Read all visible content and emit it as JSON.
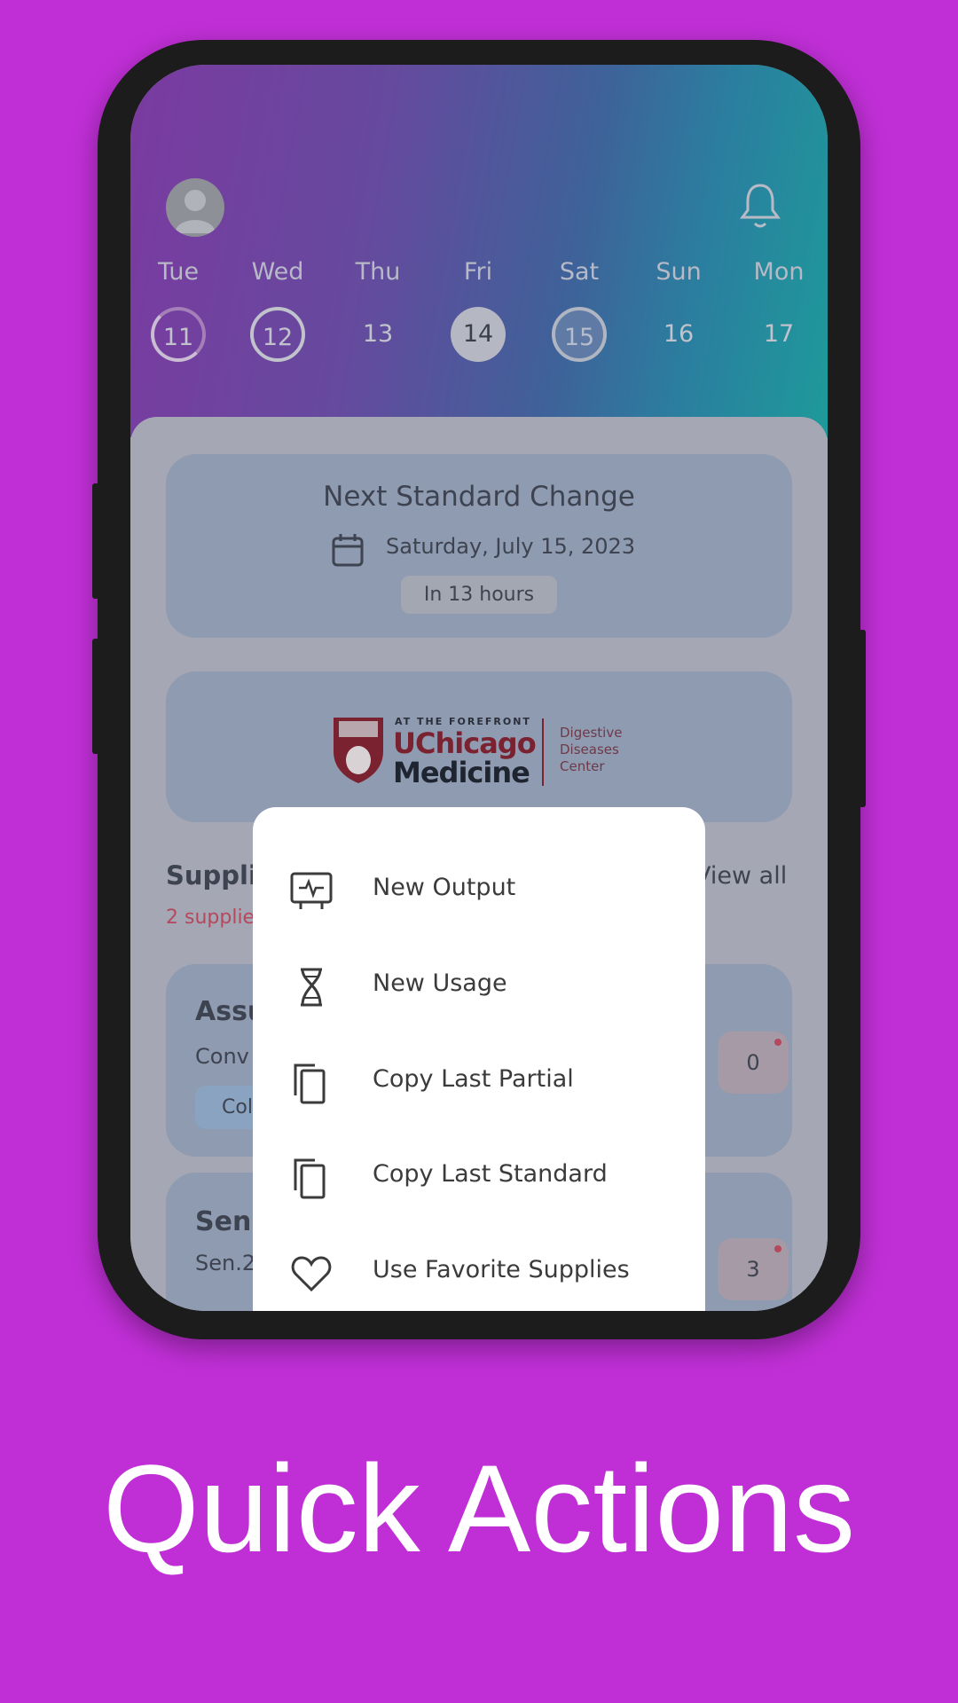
{
  "colors": {
    "background": "#c02fd6",
    "warning_text": "#b5485c",
    "logo_red": "#800000"
  },
  "header": {
    "avatar_icon": "user-avatar-icon",
    "bell_icon": "bell-icon",
    "days": [
      {
        "label": "Tue",
        "date": "11",
        "state": "partial-ring"
      },
      {
        "label": "Wed",
        "date": "12",
        "state": "ring"
      },
      {
        "label": "Thu",
        "date": "13",
        "state": "plain"
      },
      {
        "label": "Fri",
        "date": "14",
        "state": "selected"
      },
      {
        "label": "Sat",
        "date": "15",
        "state": "change-day"
      },
      {
        "label": "Sun",
        "date": "16",
        "state": "plain"
      },
      {
        "label": "Mon",
        "date": "17",
        "state": "plain"
      }
    ]
  },
  "next_change": {
    "title": "Next Standard Change",
    "date": "Saturday, July 15, 2023",
    "countdown": "In 13 hours",
    "icon": "calendar-icon"
  },
  "logo": {
    "tagline": "AT THE FOREFRONT",
    "name_line1": "UChicago",
    "name_line2": "Medicine",
    "division": [
      "Digestive",
      "Diseases",
      "Center"
    ]
  },
  "supplies": {
    "heading": "Suppli",
    "view_all": "View all",
    "warning": "2 supplie",
    "items": [
      {
        "name": "Assu",
        "subtitle": "Conv",
        "chip": "Col",
        "count": "0"
      },
      {
        "name": "Sen",
        "subtitle": "Sen.2",
        "count": "3"
      }
    ]
  },
  "quick_actions_menu": [
    {
      "label": "New Output",
      "icon": "monitor-pulse-icon"
    },
    {
      "label": "New Usage",
      "icon": "hourglass-dna-icon"
    },
    {
      "label": "Copy Last Partial",
      "icon": "copy-icon"
    },
    {
      "label": "Copy Last Standard",
      "icon": "copy-icon"
    },
    {
      "label": "Use Favorite Supplies",
      "icon": "heart-icon"
    }
  ],
  "caption": "Quick Actions"
}
